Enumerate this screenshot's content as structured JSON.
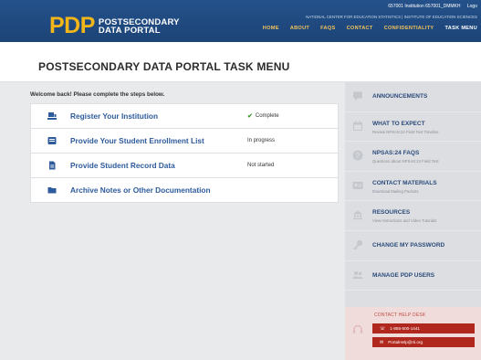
{
  "header": {
    "logo_mark": "PDP",
    "logo_line1": "POSTSECONDARY",
    "logo_line2": "DATA PORTAL",
    "user_text": "657001 Institution 657001_DMMKH",
    "logout_label": "Logo",
    "org_text": "NATIONAL CENTER FOR EDUCATION STATISTICS  |  INSTITUTE OF EDUCATION SCIENCES",
    "nav": [
      "HOME",
      "ABOUT",
      "FAQS",
      "CONTACT",
      "CONFIDENTIALITY",
      "TASK MENU"
    ],
    "colors": {
      "header_bg": "#1f4a80",
      "logo_gold": "#f2b619",
      "nav_gold": "#f1c25a"
    }
  },
  "page": {
    "title": "POSTSECONDARY DATA PORTAL TASK MENU"
  },
  "main": {
    "welcome": "Welcome back! Please complete the steps below.",
    "tasks": [
      {
        "icon": "institution-icon",
        "label": "Register Your Institution",
        "status": "Complete",
        "status_icon": "checkmark-icon"
      },
      {
        "icon": "list-icon",
        "label": "Provide Your Student Enrollment List",
        "status": "In progress"
      },
      {
        "icon": "document-icon",
        "label": "Provide Student Record Data",
        "status": "Not started"
      },
      {
        "icon": "folder-icon",
        "label": "Archive Notes or Other Documentation",
        "status": ""
      }
    ]
  },
  "sidebar": {
    "items": [
      {
        "icon": "announcement-icon",
        "title": "ANNOUNCEMENTS",
        "subtitle": ""
      },
      {
        "icon": "calendar-icon",
        "title": "WHAT TO EXPECT",
        "subtitle": "Review NPSAS:24 Field Test Timeline"
      },
      {
        "icon": "question-icon",
        "title": "NPSAS:24 FAQS",
        "subtitle": "Questions about NPSAS:24 Field Test"
      },
      {
        "icon": "contact-card-icon",
        "title": "CONTACT MATERIALS",
        "subtitle": "Download Mailing Packets"
      },
      {
        "icon": "resources-icon",
        "title": "RESOURCES",
        "subtitle": "View Instructions and Video Tutorials"
      },
      {
        "icon": "key-icon",
        "title": "CHANGE MY PASSWORD",
        "subtitle": ""
      },
      {
        "icon": "users-icon",
        "title": "MANAGE PDP USERS",
        "subtitle": ""
      }
    ],
    "help": {
      "title": "CONTACT HELP DESK",
      "phone": "1-855-500-1441",
      "email": "PortalHelp@rti.org"
    }
  }
}
